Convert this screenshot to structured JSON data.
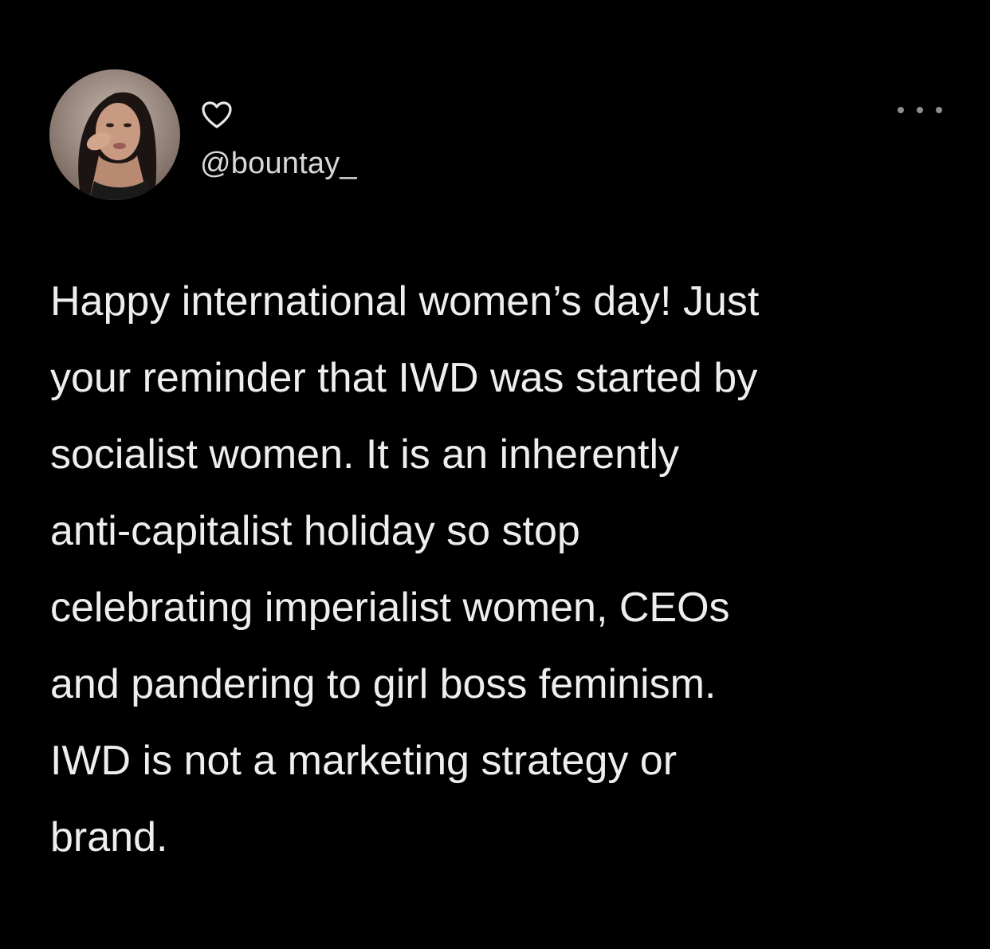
{
  "tweet": {
    "avatar_icon": "profile-photo",
    "badge_icon": "heart-outline-icon",
    "handle": "@bountay_",
    "more_icon": "more-options-icon",
    "text": "Happy international women’s day! Just\nyour reminder that IWD was started by\nsocialist women. It is an inherently\nanti-capitalist holiday so stop\ncelebrating imperialist women, CEOs\nand pandering to girl boss feminism.\nIWD is not a marketing strategy or\nbrand."
  },
  "colors": {
    "background": "#000000",
    "text": "#eceef0",
    "muted": "#8b8f92"
  }
}
